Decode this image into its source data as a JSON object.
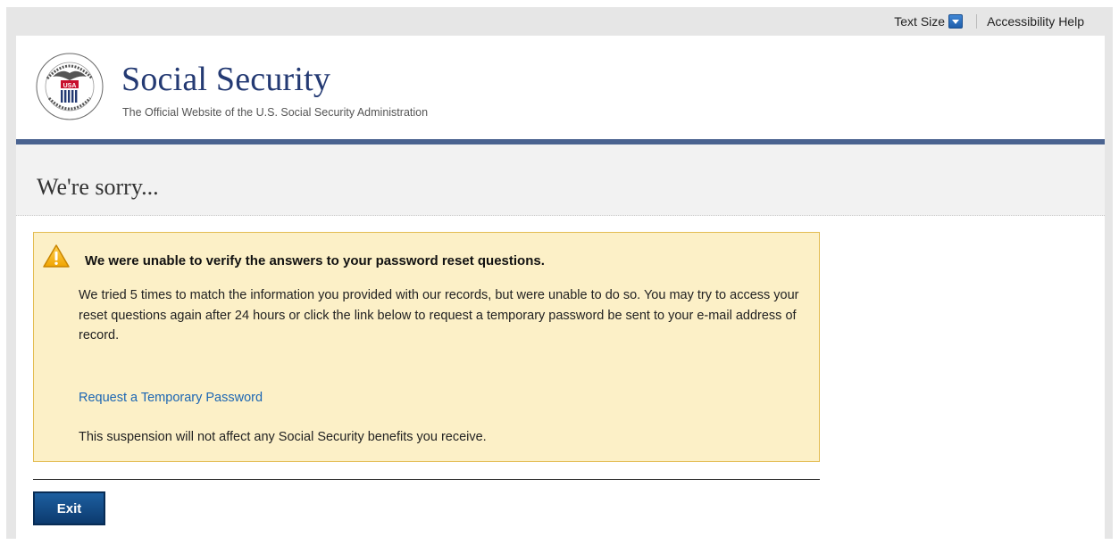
{
  "topbar": {
    "text_size_label": "Text Size",
    "accessibility_help_label": "Accessibility Help"
  },
  "header": {
    "title": "Social Security",
    "subtitle": "The Official Website of the U.S. Social Security Administration",
    "seal_icon": "ssa-seal-icon"
  },
  "page": {
    "title": "We're sorry..."
  },
  "alert": {
    "icon": "warning-icon",
    "heading": "We were unable to verify the answers to your password reset questions.",
    "body": "We tried 5 times to match the information you provided with our records, but were unable to do so. You may try to access your reset questions again after 24 hours or click the link below to request a temporary password be sent to your e-mail address of record.",
    "link_label": "Request a Temporary Password",
    "note": "This suspension will not affect any Social Security benefits you receive."
  },
  "actions": {
    "exit_label": "Exit"
  },
  "colors": {
    "brand_blue": "#243a73",
    "header_bar": "#4a6390",
    "alert_bg": "#fcf0c7",
    "alert_border": "#e3bc52",
    "link": "#1c66b3",
    "button": "#0c3a6e"
  }
}
